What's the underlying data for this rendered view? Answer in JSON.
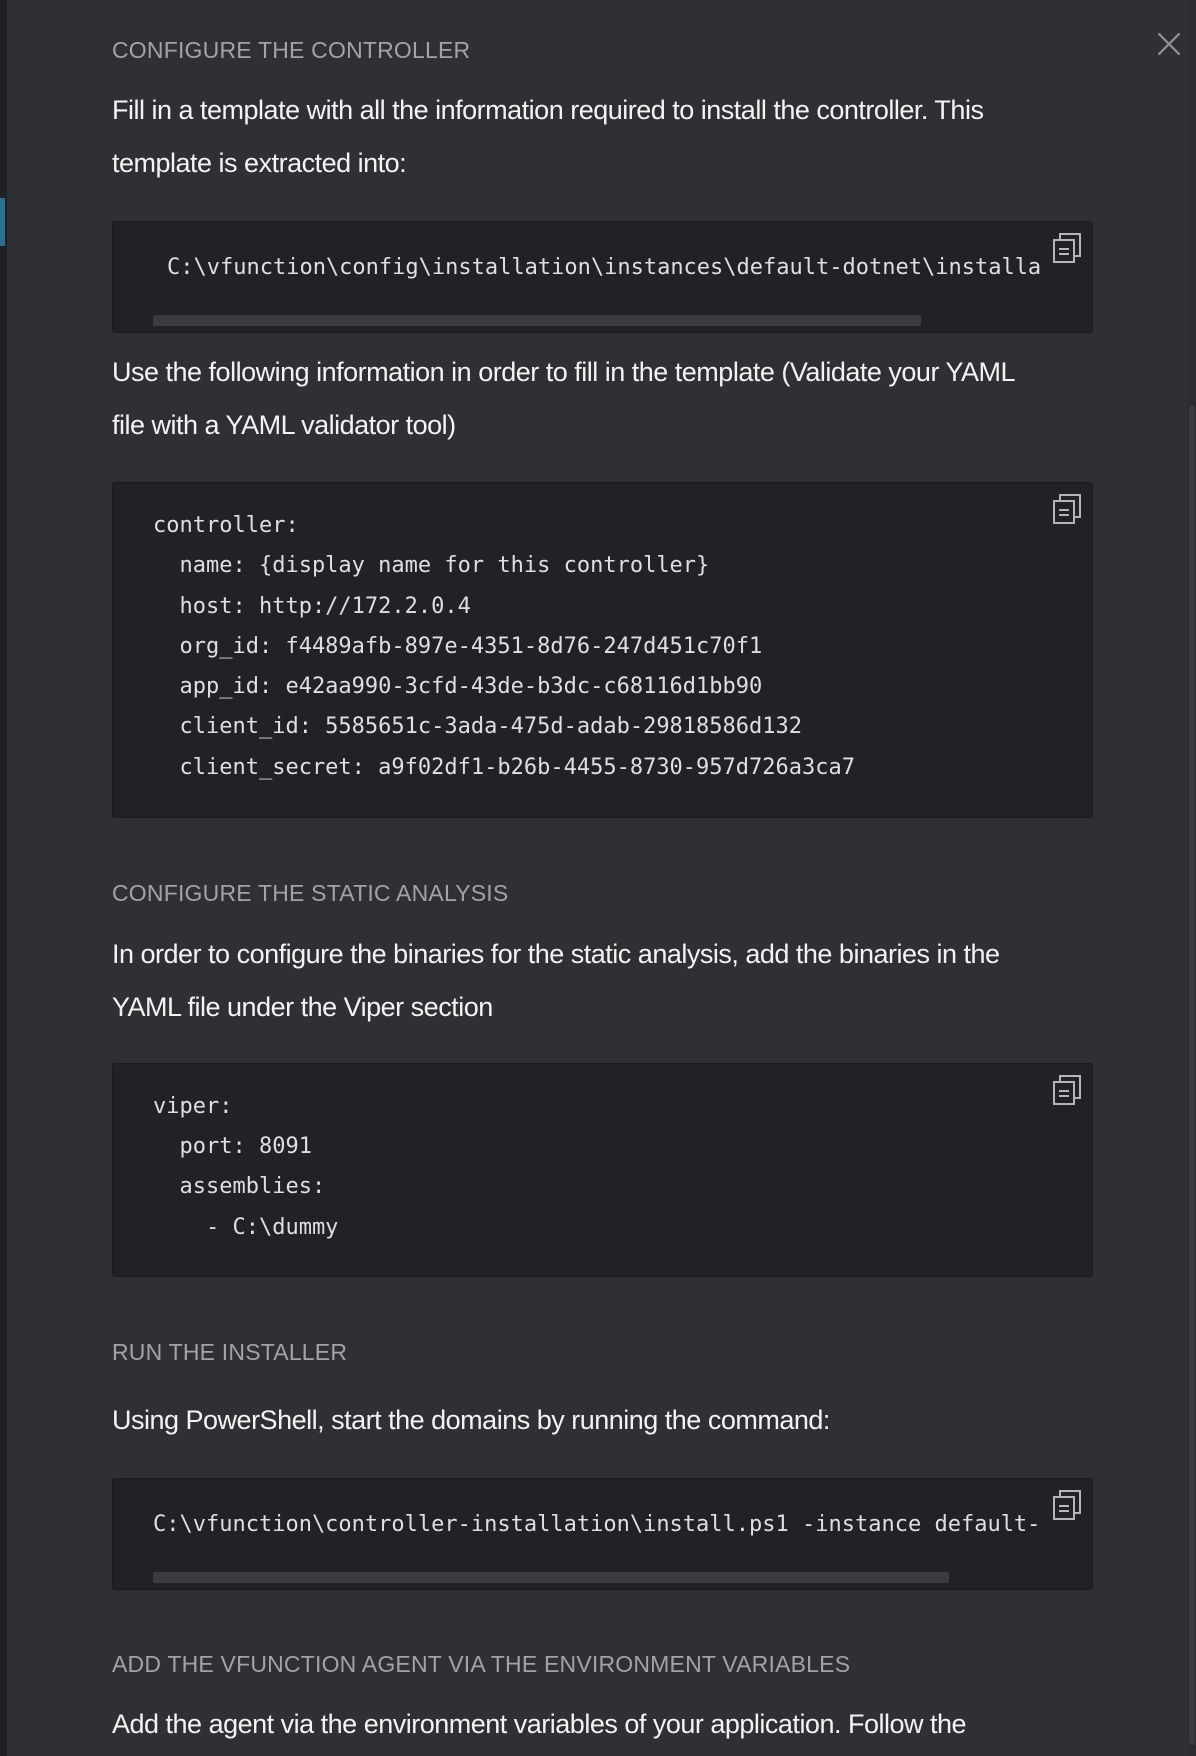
{
  "sections": {
    "controller": {
      "title": "CONFIGURE THE CONTROLLER",
      "para1_line1": "Fill in a template with all the information required to install the controller. This",
      "para1_line2": "template is extracted into:",
      "path_code": "C:\\vfunction\\config\\installation\\instances\\default-dotnet\\installa",
      "para2_line1": "Use the following information in order to fill in the template (Validate your YAML",
      "para2_line2": "file with a YAML validator tool)",
      "yaml_lines": [
        "controller:",
        "  name: {display name for this controller}",
        "  host: http://172.2.0.4",
        "  org_id: f4489afb-897e-4351-8d76-247d451c70f1",
        "  app_id: e42aa990-3cfd-43de-b3dc-c68116d1bb90",
        "  client_id: 5585651c-3ada-475d-adab-29818586d132",
        "  client_secret: a9f02df1-b26b-4455-8730-957d726a3ca7"
      ]
    },
    "static_analysis": {
      "title": "CONFIGURE THE STATIC ANALYSIS",
      "para_line1": "In order to configure the binaries for the static analysis, add the binaries in the",
      "para_line2": "YAML file under the Viper section",
      "yaml_lines": [
        "viper:",
        "  port: 8091",
        "  assemblies:",
        "    - C:\\dummy"
      ]
    },
    "installer": {
      "title": "RUN THE INSTALLER",
      "para": "Using PowerShell, start the domains by running the command:",
      "command": "C:\\vfunction\\controller-installation\\install.ps1 -instance default-"
    },
    "agent": {
      "title": "ADD THE VFUNCTION AGENT VIA THE ENVIRONMENT VARIABLES",
      "para": "Add the agent via the environment variables of your application. Follow the"
    }
  },
  "icons": {
    "close": "close-icon",
    "copy": "copy-icon"
  },
  "colors": {
    "background": "#2f3034",
    "code_background": "#212226",
    "section_title": "#a1a3a8",
    "text": "#f3f3f4"
  }
}
